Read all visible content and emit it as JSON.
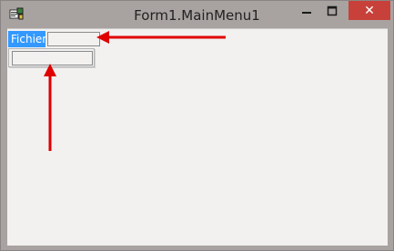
{
  "window": {
    "title": "Form1.MainMenu1",
    "close_glyph": "✕",
    "close_color": "#c7413a"
  },
  "menu": {
    "items": [
      {
        "label": "Fichier",
        "selected": true
      },
      {
        "label": ""
      }
    ],
    "dropdown": {
      "items": [
        {
          "label": ""
        }
      ]
    }
  },
  "annotations": {
    "arrow_color": "#e00000"
  }
}
